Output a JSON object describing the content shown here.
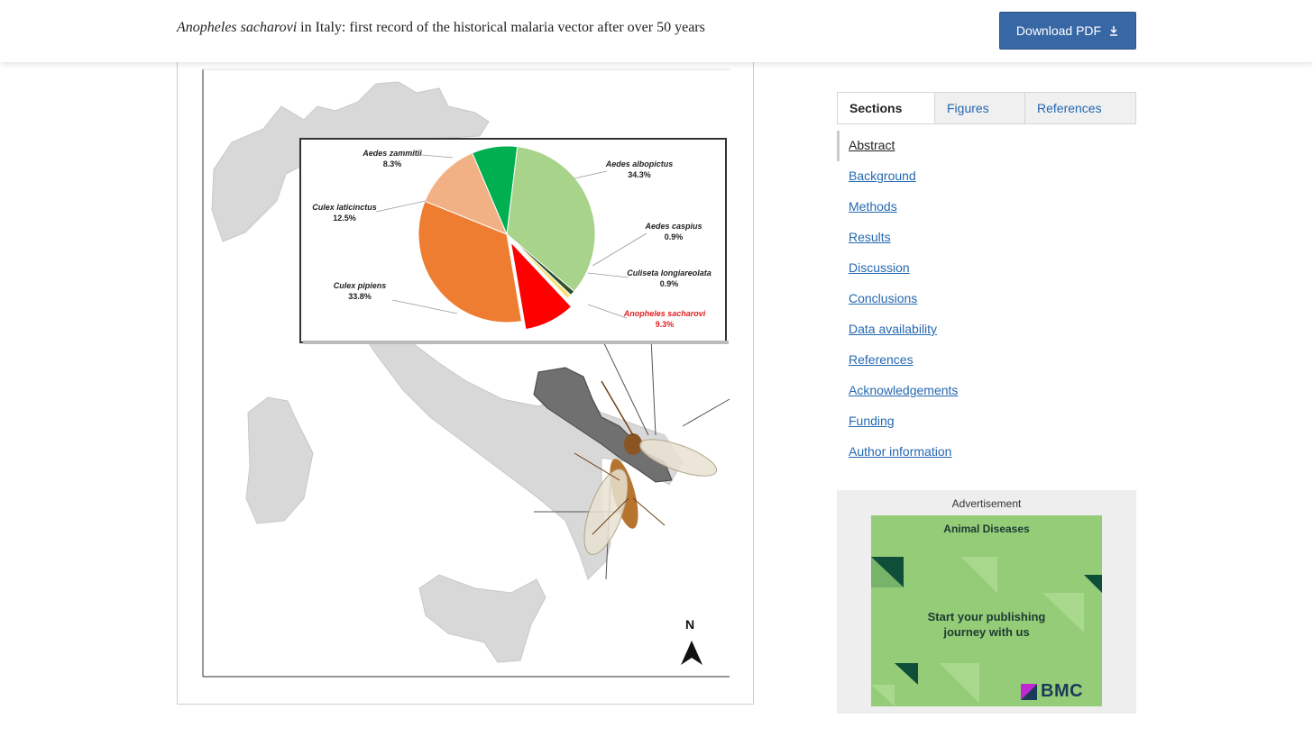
{
  "header": {
    "title_italic": "Anopheles sacharovi",
    "title_rest": " in Italy: first record of the historical malaria vector after over 50 years",
    "download_label": "Download PDF"
  },
  "figure": {
    "north_label": "N",
    "pie_title": "",
    "chart_data": {
      "type": "pie",
      "title": "",
      "slices": [
        {
          "label": "Aedes albopictus",
          "value": 34.3,
          "display": "34.3%",
          "color": "#a8d38a"
        },
        {
          "label": "Aedes caspius",
          "value": 0.9,
          "display": "0.9%",
          "color": "#2f4f2a"
        },
        {
          "label": "Culiseta longiareolata",
          "value": 0.9,
          "display": "0.9%",
          "color": "#f7e27a"
        },
        {
          "label": "Anopheles sacharovi",
          "value": 9.3,
          "display": "9.3%",
          "color": "#ff0000",
          "exploded": true
        },
        {
          "label": "Culex pipiens",
          "value": 33.8,
          "display": "33.8%",
          "color": "#ee7d31"
        },
        {
          "label": "Culex laticinctus",
          "value": 12.5,
          "display": "12.5%",
          "color": "#f2b085"
        },
        {
          "label": "Aedes zammitii",
          "value": 8.3,
          "display": "8.3%",
          "color": "#00b050"
        }
      ]
    }
  },
  "tabs": [
    {
      "label": "Sections",
      "active": true
    },
    {
      "label": "Figures",
      "active": false
    },
    {
      "label": "References",
      "active": false
    }
  ],
  "sections": [
    "Abstract",
    "Background",
    "Methods",
    "Results",
    "Discussion",
    "Conclusions",
    "Data availability",
    "References",
    "Acknowledgements",
    "Funding",
    "Author information"
  ],
  "ad": {
    "label": "Advertisement",
    "heading": "Animal Diseases",
    "body": "Start your publishing\njourney with us",
    "brand": "BMC",
    "colors": {
      "background": "#95cc77",
      "dark": "#0f4f3a",
      "brand_accent": "#c026d3"
    }
  },
  "icons": {
    "download": "download-icon",
    "north_arrow": "north-arrow-icon",
    "bmc_logo": "bmc-logo-icon"
  }
}
